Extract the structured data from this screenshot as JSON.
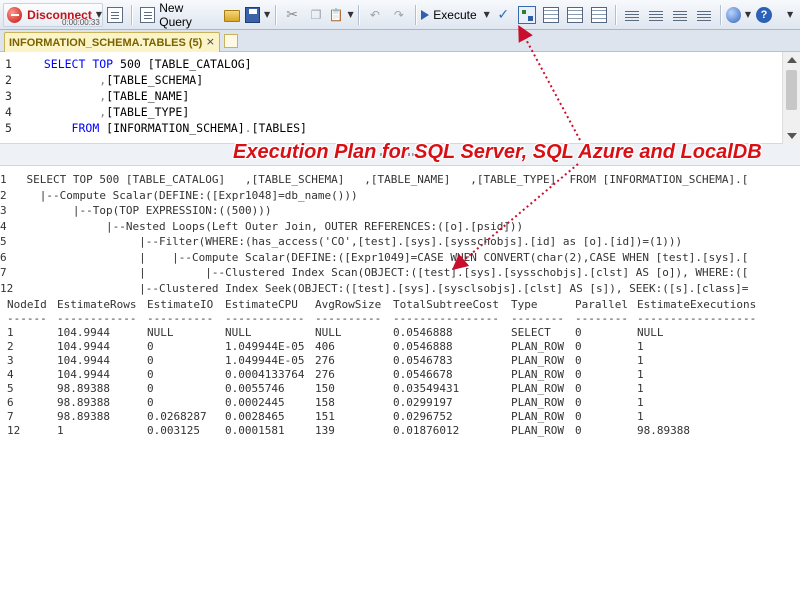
{
  "toolbar": {
    "disconnect_label": "Disconnect",
    "timer": "0:00:00:33",
    "new_query_label": "New Query",
    "execute_label": "Execute"
  },
  "tab": {
    "title": "INFORMATION_SCHEMA.TABLES (5)",
    "close": "×"
  },
  "editor": {
    "lines": [
      {
        "n": "1",
        "parts": [
          {
            "t": "SELECT TOP ",
            "k": "kw"
          },
          {
            "t": "500",
            "k": "num"
          },
          {
            "t": " [TABLE_CATALOG]",
            "k": "plain"
          }
        ],
        "indent": "  "
      },
      {
        "n": "2",
        "parts": [
          {
            "t": ",",
            "k": "op"
          },
          {
            "t": "[TABLE_SCHEMA]",
            "k": "plain"
          }
        ],
        "indent": "          "
      },
      {
        "n": "3",
        "parts": [
          {
            "t": ",",
            "k": "op"
          },
          {
            "t": "[TABLE_NAME]",
            "k": "plain"
          }
        ],
        "indent": "          "
      },
      {
        "n": "4",
        "parts": [
          {
            "t": ",",
            "k": "op"
          },
          {
            "t": "[TABLE_TYPE]",
            "k": "plain"
          }
        ],
        "indent": "          "
      },
      {
        "n": "5",
        "parts": [
          {
            "t": "FROM ",
            "k": "kw"
          },
          {
            "t": "[INFORMATION_SCHEMA]",
            "k": "plain"
          },
          {
            "t": ".",
            "k": "op"
          },
          {
            "t": "[TABLES]",
            "k": "plain"
          }
        ],
        "indent": "      "
      }
    ]
  },
  "callout": "Execution Plan for SQL Server, SQL Azure and LocalDB",
  "plan_text": [
    "1   SELECT TOP 500 [TABLE_CATALOG]   ,[TABLE_SCHEMA]   ,[TABLE_NAME]   ,[TABLE_TYPE]  FROM [INFORMATION_SCHEMA].[",
    "2     |--Compute Scalar(DEFINE:([Expr1048]=db_name()))",
    "3          |--Top(TOP EXPRESSION:((500)))",
    "4               |--Nested Loops(Left Outer Join, OUTER REFERENCES:([o].[psid]))",
    "5                    |--Filter(WHERE:(has_access('CO',[test].[sys].[sysschobjs].[id] as [o].[id])=(1)))",
    "6                    |    |--Compute Scalar(DEFINE:([Expr1049]=CASE WHEN CONVERT(char(2),CASE WHEN [test].[sys].[",
    "7                    |         |--Clustered Index Scan(OBJECT:([test].[sys].[sysschobjs].[clst] AS [o]), WHERE:([",
    "12                   |--Clustered Index Seek(OBJECT:([test].[sys].[sysclsobjs].[clst] AS [s]), SEEK:([s].[class]="
  ],
  "table": {
    "headers": [
      "NodeId",
      "EstimateRows",
      "EstimateIO",
      "EstimateCPU",
      "AvgRowSize",
      "TotalSubtreeCost",
      "Type",
      "Parallel",
      "EstimateExecutions"
    ],
    "dashes": [
      "------",
      "------------",
      "----------",
      "------------",
      "----------",
      "----------------",
      "--------",
      "--------",
      "------------------"
    ],
    "rows": [
      [
        "1",
        "104.9944",
        "NULL",
        "NULL",
        "NULL",
        "0.0546888",
        "SELECT",
        "0",
        "NULL"
      ],
      [
        "2",
        "104.9944",
        "0",
        "1.049944E-05",
        "406",
        "0.0546888",
        "PLAN_ROW",
        "0",
        "1"
      ],
      [
        "3",
        "104.9944",
        "0",
        "1.049944E-05",
        "276",
        "0.0546783",
        "PLAN_ROW",
        "0",
        "1"
      ],
      [
        "4",
        "104.9944",
        "0",
        "0.0004133764",
        "276",
        "0.0546678",
        "PLAN_ROW",
        "0",
        "1"
      ],
      [
        "5",
        "98.89388",
        "0",
        "0.0055746",
        "150",
        "0.03549431",
        "PLAN_ROW",
        "0",
        "1"
      ],
      [
        "6",
        "98.89388",
        "0",
        "0.0002445",
        "158",
        "0.0299197",
        "PLAN_ROW",
        "0",
        "1"
      ],
      [
        "7",
        "98.89388",
        "0.0268287",
        "0.0028465",
        "151",
        "0.0296752",
        "PLAN_ROW",
        "0",
        "1"
      ],
      [
        "12",
        "1",
        "0.003125",
        "0.0001581",
        "139",
        "0.01876012",
        "PLAN_ROW",
        "0",
        "98.89388"
      ]
    ]
  },
  "colors": {
    "keyword": "#0000ff",
    "callout": "#d81016",
    "arrow": "#c8102e"
  }
}
